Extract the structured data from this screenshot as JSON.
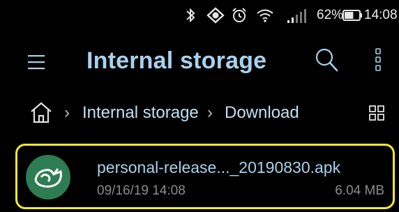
{
  "status_bar": {
    "icons": [
      "bluetooth-icon",
      "do-not-disturb-icon",
      "alarm-icon",
      "wifi-icon",
      "signal-icon",
      "battery-icon"
    ],
    "battery_percent": "62%",
    "battery_level": 0.62,
    "time": "14:08"
  },
  "toolbar": {
    "title": "Internal storage",
    "icons": [
      "menu-icon",
      "search-icon",
      "more-vert-icon"
    ]
  },
  "breadcrumb": {
    "home_icon": "home-icon",
    "items": [
      "Internal storage",
      "Download"
    ],
    "view_toggle_icon": "grid-view-icon"
  },
  "file": {
    "name": "personal-release..._20190830.apk",
    "date": "09/16/19 14:08",
    "size": "6.04 MB",
    "icon": "app-logo-icon"
  },
  "colors": {
    "background": "#000000",
    "title": "#a7d2ed",
    "highlight": "#f2ea2a",
    "app_icon_bg": "#2e7d52",
    "secondary_text": "#8c8c8c"
  }
}
